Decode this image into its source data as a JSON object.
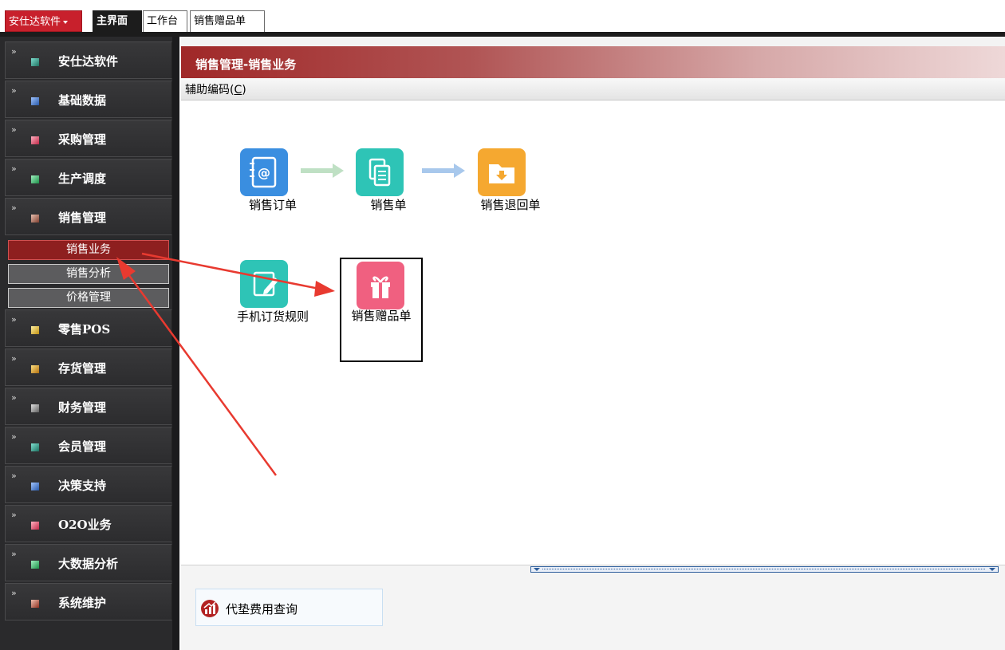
{
  "topbar": {
    "app_menu_label": "安仕达软件",
    "tabs": [
      {
        "label": "主界面"
      },
      {
        "label": "工作台"
      },
      {
        "label": "销售赠品单"
      }
    ]
  },
  "sidebar": {
    "items": [
      {
        "label": "安仕达软件",
        "color": "#30a090"
      },
      {
        "label": "基础数据",
        "color": "#4a7fd0"
      },
      {
        "label": "采购管理",
        "color": "#e04860"
      },
      {
        "label": "生产调度",
        "color": "#3cc070"
      },
      {
        "label": "销售管理",
        "color": "#b07a6a"
      },
      {
        "label": "零售POS",
        "color": "#e8c030"
      },
      {
        "label": "存货管理",
        "color": "#e8b830"
      },
      {
        "label": "财务管理",
        "color": "#a0a0a0"
      },
      {
        "label": "会员管理",
        "color": "#30a090"
      },
      {
        "label": "决策支持",
        "color": "#4a7fd0"
      },
      {
        "label": "O2O业务",
        "color": "#e04860"
      },
      {
        "label": "大数据分析",
        "color": "#3cc070"
      },
      {
        "label": "系统维护",
        "color": "#c06a5a"
      }
    ],
    "sub_items": [
      {
        "label": "销售业务"
      },
      {
        "label": "销售分析"
      },
      {
        "label": "价格管理"
      }
    ]
  },
  "main": {
    "title": "销售管理-销售业务",
    "sub_toolbar": "辅助编码(C)",
    "functions": [
      {
        "label": "销售订单",
        "icon": "address-book-icon",
        "color": "#3a8ee0"
      },
      {
        "label": "销售单",
        "icon": "document-icon",
        "color": "#2ec4b6"
      },
      {
        "label": "销售退回单",
        "icon": "folder-download-icon",
        "color": "#f5a830"
      },
      {
        "label": "手机订货规则",
        "icon": "edit-icon",
        "color": "#2ec4b6"
      },
      {
        "label": "销售赠品单",
        "icon": "gift-icon",
        "color": "#f06080"
      }
    ],
    "query_button": "代垫费用查询"
  },
  "colors": {
    "accent_red": "#8e1f1f",
    "sidebar_bg": "#2a2a2c",
    "highlight_border": "#000000",
    "annotation_arrow": "#e83a30"
  }
}
